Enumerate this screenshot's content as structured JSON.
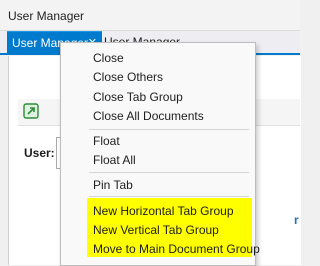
{
  "window": {
    "title": "User Manager"
  },
  "tabs": {
    "active": {
      "label": "User Manager",
      "close_glyph": "✕"
    },
    "inactive": {
      "label": "User Manager"
    }
  },
  "content": {
    "user_label": "User:"
  },
  "context_menu": {
    "items": [
      {
        "label": "Close"
      },
      {
        "label": "Close Others"
      },
      {
        "label": "Close Tab Group"
      },
      {
        "label": "Close All Documents"
      },
      {
        "label": "Float"
      },
      {
        "label": "Float All"
      },
      {
        "label": "Pin Tab"
      },
      {
        "label": "New Horizontal Tab Group"
      },
      {
        "label": "New Vertical Tab Group"
      },
      {
        "label": "Move to Main Document Group"
      }
    ]
  },
  "colors": {
    "accent": "#007acc",
    "highlight": "#ffff00"
  },
  "icons": {
    "toolbar": "green-export-icon"
  }
}
